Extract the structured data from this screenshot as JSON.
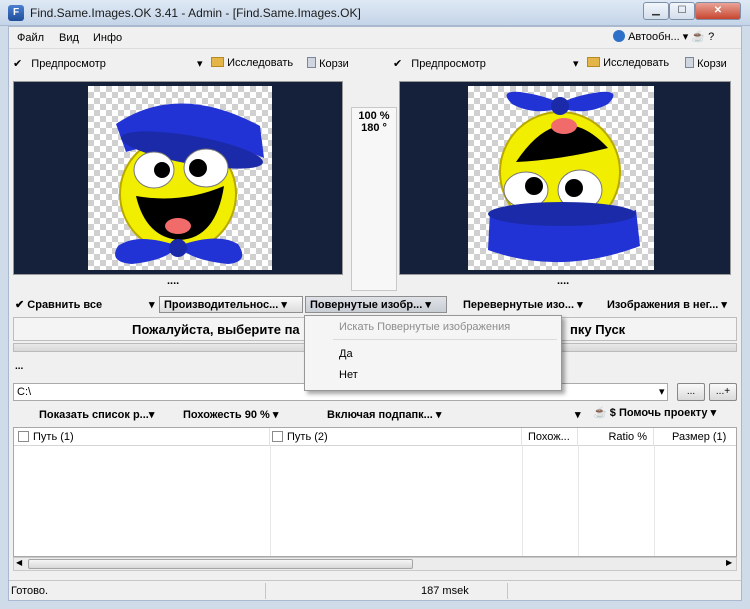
{
  "window": {
    "title": "Find.Same.Images.OK 3.41 - Admin - [Find.Same.Images.OK]",
    "app_icon_glyph": "F",
    "min_glyph": "▁",
    "max_glyph": "☐",
    "close_glyph": "✕"
  },
  "menu": {
    "items": [
      "Файл",
      "Вид",
      "Инфо"
    ],
    "auto_label": "Автообн...",
    "extra_icons": "▾ ☕ ?"
  },
  "preview_left": {
    "check_label": "Предпросмотр",
    "explore_label": "Исследовать",
    "trash_label": "Корзи",
    "footer_dots": "...."
  },
  "preview_right": {
    "check_label": "Предпросмотр",
    "explore_label": "Исследовать",
    "trash_label": "Корзи",
    "footer_dots": "...."
  },
  "zoom": {
    "percent": "100 %",
    "angle": "180 °"
  },
  "compare": {
    "compare_all": "Сравнить все",
    "performance": "Производительнос...",
    "rotated": "Повернутые изобр...",
    "flipped": "Перевернутые изо...",
    "images_in": "Изображения в нег..."
  },
  "message": {
    "text_left": "Пожалуйста, выберите па",
    "text_right": "пку Пуск"
  },
  "dots_marker": "...",
  "path": {
    "value": "C:\\",
    "browse_label": "...",
    "add_label": "...+"
  },
  "options": {
    "show_list": "Показать список р...",
    "similarity": "Похожесть 90 %",
    "include_sub": "Включая подпапк...",
    "help_project": "$ Помочь проекту"
  },
  "table": {
    "headers": [
      "Путь (1)",
      "Путь (2)",
      "Похож...",
      "Ratio %",
      "Размер (1)"
    ]
  },
  "status": {
    "left": "Готово.",
    "time": "187 msek"
  },
  "popup": {
    "title": "Искать Повернутые изображения",
    "options": [
      "Да",
      "Нет"
    ]
  },
  "colors": {
    "preview_bg": "#15213a",
    "smiley_yellow": "#f2ee00",
    "hat_blue": "#2233d6"
  }
}
